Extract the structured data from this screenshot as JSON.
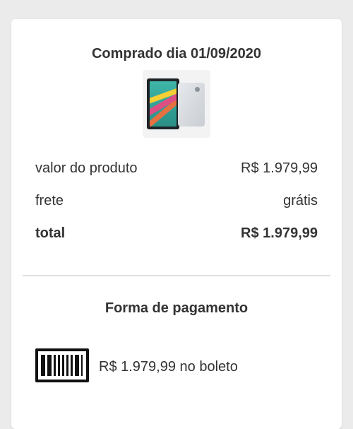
{
  "order": {
    "title": "Comprado dia 01/09/2020",
    "product_image": "samsung-galaxy-tablet-thumbnail"
  },
  "summary": {
    "rows": [
      {
        "label": "valor do produto",
        "value": "R$ 1.979,99",
        "bold": false
      },
      {
        "label": "frete",
        "value": "grátis",
        "bold": false
      },
      {
        "label": "total",
        "value": "R$ 1.979,99",
        "bold": true
      }
    ]
  },
  "payment": {
    "title": "Forma de pagamento",
    "icon": "barcode-icon",
    "text": "R$ 1.979,99 no boleto"
  },
  "colors": {
    "background": "#ebebeb",
    "card": "#ffffff",
    "text": "#333333",
    "divider": "#e0e0e0"
  }
}
